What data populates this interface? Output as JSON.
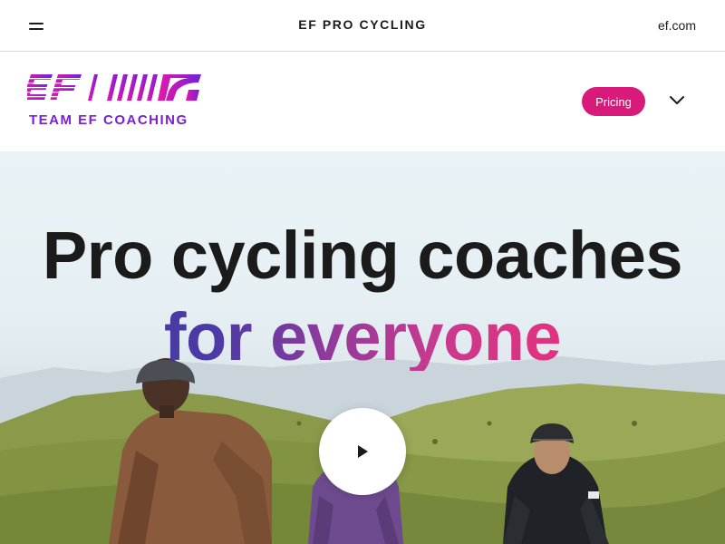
{
  "topbar": {
    "menu_icon": "hamburger-icon",
    "brand": "EF PRO CYCLING",
    "external_link": "ef.com"
  },
  "subheader": {
    "logo_text": "TEAM EF COACHING",
    "pricing_label": "Pricing",
    "expand_icon": "chevron-down-icon"
  },
  "hero": {
    "headline_line1": "Pro cycling coaches",
    "headline_line2": "for everyone",
    "play_icon": "play-icon"
  },
  "colors": {
    "accent_pink": "#d81b7a",
    "logo_magenta": "#d81bb0",
    "logo_purple": "#7a1fd6",
    "gradient_start": "#3d3a9e",
    "gradient_end": "#e6307a"
  }
}
